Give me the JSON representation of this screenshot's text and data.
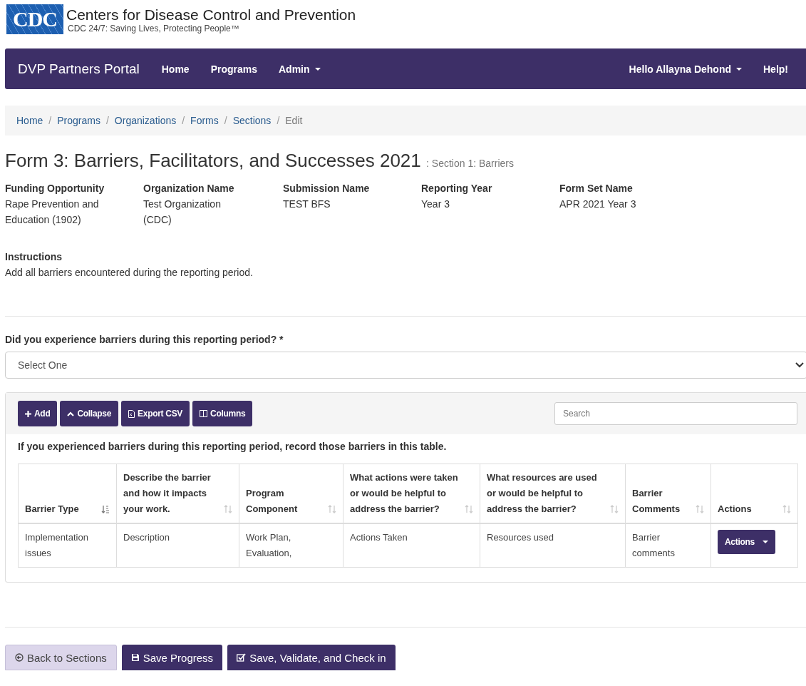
{
  "header": {
    "logo": "CDC",
    "title": "Centers for Disease Control and Prevention",
    "tagline": "CDC 24/7: Saving Lives, Protecting People™"
  },
  "navbar": {
    "brand": "DVP Partners Portal",
    "items": [
      {
        "label": "Home",
        "dropdown": false
      },
      {
        "label": "Programs",
        "dropdown": false
      },
      {
        "label": "Admin",
        "dropdown": true
      }
    ],
    "right_items": [
      {
        "label": "Hello Allayna Dehond",
        "dropdown": true
      },
      {
        "label": "Help!",
        "dropdown": false
      }
    ]
  },
  "breadcrumb_separator": "/",
  "breadcrumb": [
    {
      "label": "Home",
      "selected": false
    },
    {
      "label": "Programs",
      "selected": false
    },
    {
      "label": "Organizations",
      "selected": false
    },
    {
      "label": "Forms",
      "selected": false
    },
    {
      "label": "Sections",
      "selected": false
    },
    {
      "label": "Edit",
      "selected": true
    }
  ],
  "page_title": "Form 3: Barriers, Facilitators, and Successes 2021",
  "page_subtitle": ": Section 1: Barriers",
  "meta": [
    {
      "label": "Funding Opportunity",
      "value": "Rape Prevention and Education (1902)"
    },
    {
      "label": "Organization Name",
      "value": "Test Organization (CDC)"
    },
    {
      "label": "Submission Name",
      "value": "TEST BFS"
    },
    {
      "label": "Reporting Year",
      "value": "Year 3"
    },
    {
      "label": "Form Set Name",
      "value": "APR 2021 Year 3"
    }
  ],
  "instructions": {
    "label": "Instructions",
    "text": "Add all barriers encountered during the reporting period."
  },
  "question": {
    "label": "Did you experience barriers during this reporting period?",
    "required_mark": "*",
    "value": "Select One"
  },
  "toolbar": [
    {
      "kind": "add",
      "label": "Add"
    },
    {
      "kind": "collapse",
      "label": "Collapse"
    },
    {
      "kind": "export",
      "label": "Export CSV"
    },
    {
      "kind": "columns",
      "label": "Columns"
    }
  ],
  "search": {
    "placeholder": "Search"
  },
  "table_note": "If you experienced barriers during this reporting period, record those barriers in this table.",
  "table": {
    "columns": [
      {
        "label": "Barrier Type",
        "sorted": true
      },
      {
        "label": "Describe the barrier and how it impacts your work.",
        "sorted": false
      },
      {
        "label": "Program Component",
        "sorted": false
      },
      {
        "label": "What actions were taken or would be helpful to address the barrier?",
        "sorted": false
      },
      {
        "label": "What resources are used or would be helpful to address the barrier?",
        "sorted": false
      },
      {
        "label": "Barrier Comments",
        "sorted": false
      },
      {
        "label": "Actions",
        "sorted": false
      }
    ],
    "rows": [
      {
        "cells": [
          "Implementation issues",
          "Description",
          "Work Plan, Evaluation,",
          "Actions Taken",
          "Resources used",
          "Barrier comments"
        ],
        "action": "Actions"
      }
    ]
  },
  "footer_buttons": [
    {
      "kind": "back",
      "label": "Back to Sections"
    },
    {
      "kind": "save",
      "label": "Save Progress"
    },
    {
      "kind": "check",
      "label": "Save, Validate, and Check in"
    }
  ]
}
